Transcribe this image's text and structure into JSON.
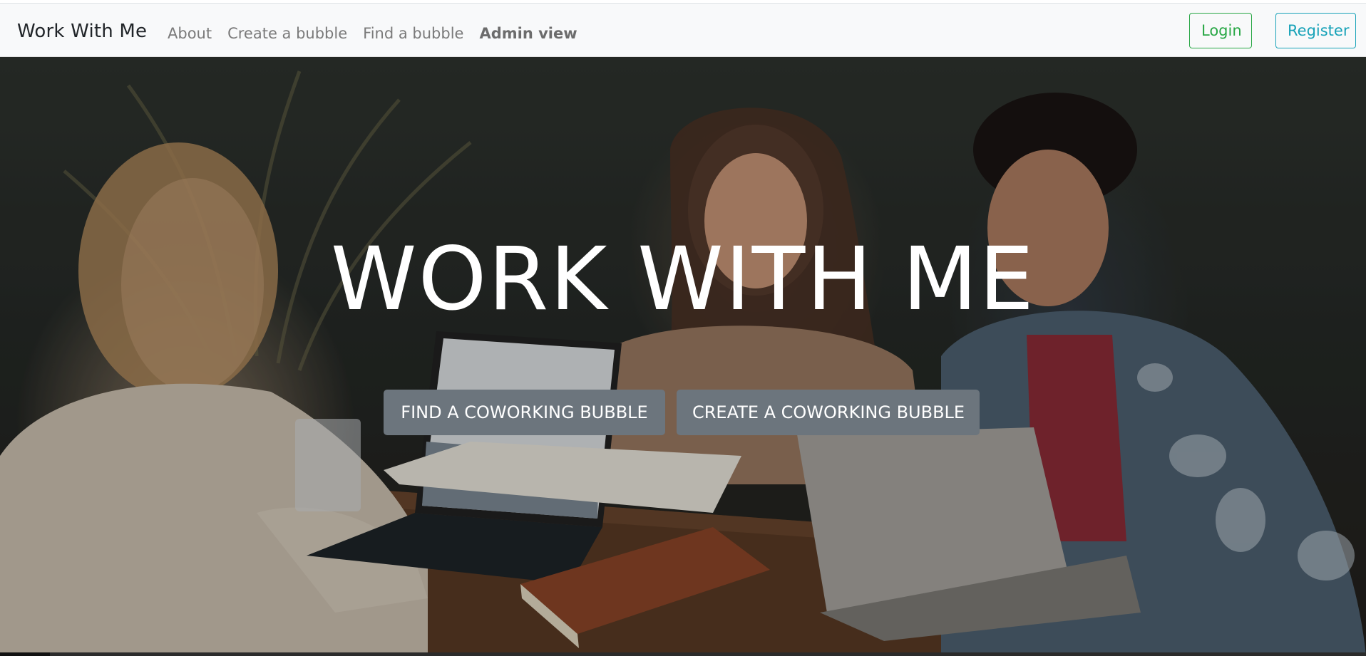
{
  "navbar": {
    "brand": "Work With Me",
    "links": [
      {
        "label": "About"
      },
      {
        "label": "Create a bubble"
      },
      {
        "label": "Find a bubble"
      },
      {
        "label": "Admin view"
      }
    ],
    "login_label": "Login",
    "register_label": "Register"
  },
  "hero": {
    "title": "WORK WITH ME",
    "find_button": "FIND A COWORKING BUBBLE",
    "create_button": "CREATE A COWORKING BUBBLE",
    "background_image": "people-working-at-cafe-table-photo"
  },
  "colors": {
    "login_outline": "#28a745",
    "register_outline": "#17a2b8",
    "hero_button_bg": "#6c757d"
  }
}
